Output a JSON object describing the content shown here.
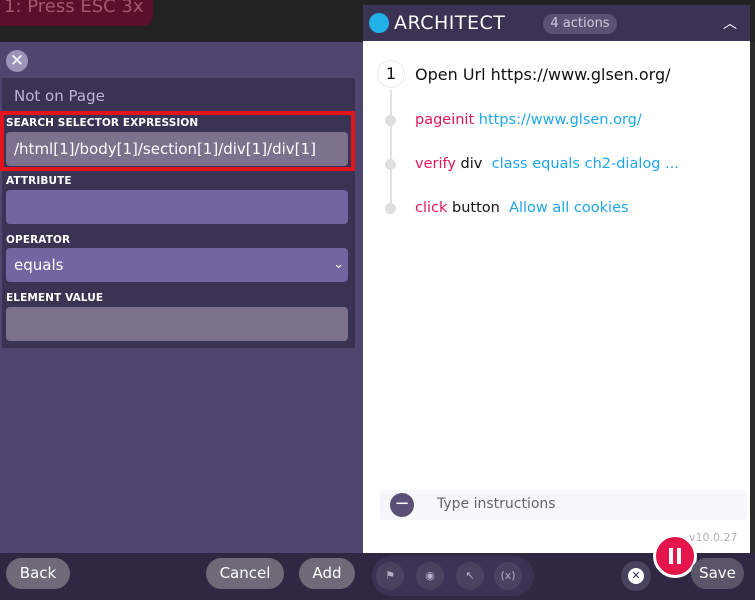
{
  "overlay": {
    "hint": "1: Press ESC 3x"
  },
  "left_panel": {
    "status": "Not on Page",
    "fields": [
      {
        "label": "SEARCH SELECTOR EXPRESSION",
        "value": "/html[1]/body[1]/section[1]/div[1]/div[1]"
      },
      {
        "label": "ATTRIBUTE",
        "value": ""
      },
      {
        "label": "OPERATOR",
        "value": "equals"
      },
      {
        "label": "ELEMENT VALUE",
        "value": ""
      }
    ],
    "buttons": {
      "back": "Back",
      "cancel": "Cancel",
      "add": "Add"
    }
  },
  "architect": {
    "title": "ARCHITECT",
    "count": "4 actions",
    "steps": [
      {
        "number": "1",
        "text": "Open Url https://www.glsen.org/"
      },
      {
        "command": "pageinit",
        "target": "",
        "value": "https://www.glsen.org/"
      },
      {
        "command": "verify",
        "target": "div",
        "value": "class equals ch2-dialog ..."
      },
      {
        "command": "click",
        "target": "button",
        "value": "Allow all cookies"
      }
    ],
    "instructions_placeholder": "Type instructions",
    "version": "v10.0.27",
    "save": "Save"
  },
  "icons": {
    "close": "close-icon",
    "logo": "architect-logo-icon",
    "collapse": "chevron-up-icon",
    "flag": "flag-icon",
    "eye": "eye-icon",
    "cursor": "cursor-icon",
    "variable": "variable-icon",
    "pause": "pause-icon",
    "minus": "minus-icon"
  },
  "colors": {
    "accent": "#e3175a",
    "link": "#1ea6e8",
    "panel": "#4e466e",
    "highlight": "#e3141d"
  }
}
